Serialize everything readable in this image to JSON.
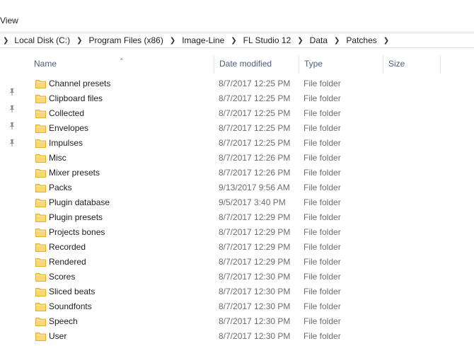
{
  "ribbon": {
    "tab_view": "View"
  },
  "address_bar": {
    "crumbs": [
      "Local Disk (C:)",
      "Program Files (x86)",
      "Image-Line",
      "FL Studio 12",
      "Data",
      "Patches"
    ]
  },
  "columns": {
    "name": "Name",
    "date_modified": "Date modified",
    "type": "Type",
    "size": "Size"
  },
  "quick_access_pins": [
    "pin-icon",
    "pin-icon",
    "pin-icon",
    "pin-icon"
  ],
  "files": [
    {
      "name": "Channel presets",
      "date": "8/7/2017 12:25 PM",
      "type": "File folder"
    },
    {
      "name": "Clipboard files",
      "date": "8/7/2017 12:25 PM",
      "type": "File folder"
    },
    {
      "name": "Collected",
      "date": "8/7/2017 12:25 PM",
      "type": "File folder"
    },
    {
      "name": "Envelopes",
      "date": "8/7/2017 12:25 PM",
      "type": "File folder"
    },
    {
      "name": "Impulses",
      "date": "8/7/2017 12:25 PM",
      "type": "File folder"
    },
    {
      "name": "Misc",
      "date": "8/7/2017 12:26 PM",
      "type": "File folder"
    },
    {
      "name": "Mixer presets",
      "date": "8/7/2017 12:26 PM",
      "type": "File folder"
    },
    {
      "name": "Packs",
      "date": "9/13/2017 9:56 AM",
      "type": "File folder"
    },
    {
      "name": "Plugin database",
      "date": "9/5/2017 3:40 PM",
      "type": "File folder"
    },
    {
      "name": "Plugin presets",
      "date": "8/7/2017 12:29 PM",
      "type": "File folder"
    },
    {
      "name": "Projects bones",
      "date": "8/7/2017 12:29 PM",
      "type": "File folder"
    },
    {
      "name": "Recorded",
      "date": "8/7/2017 12:29 PM",
      "type": "File folder"
    },
    {
      "name": "Rendered",
      "date": "8/7/2017 12:29 PM",
      "type": "File folder"
    },
    {
      "name": "Scores",
      "date": "8/7/2017 12:30 PM",
      "type": "File folder"
    },
    {
      "name": "Sliced beats",
      "date": "8/7/2017 12:30 PM",
      "type": "File folder"
    },
    {
      "name": "Soundfonts",
      "date": "8/7/2017 12:30 PM",
      "type": "File folder"
    },
    {
      "name": "Speech",
      "date": "8/7/2017 12:30 PM",
      "type": "File folder"
    },
    {
      "name": "User",
      "date": "8/7/2017 12:30 PM",
      "type": "File folder"
    }
  ],
  "colors": {
    "header_text": "#4c607a",
    "folder_yellow": "#f8d775",
    "folder_edge": "#e0b030",
    "secondary_text": "#6d6d6d"
  }
}
